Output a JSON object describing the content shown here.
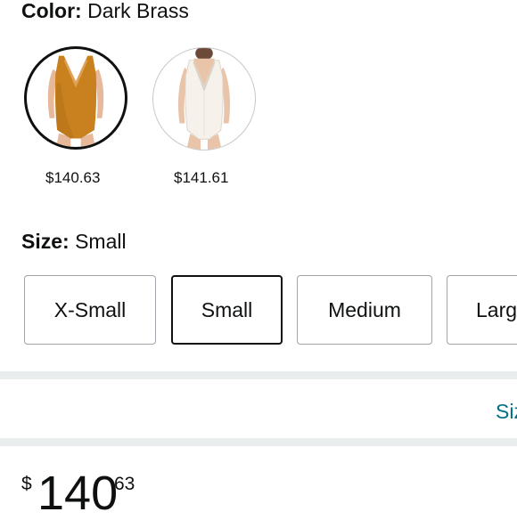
{
  "color": {
    "label": "Color:",
    "value": "Dark Brass",
    "options": [
      {
        "name": "Dark Brass",
        "price": "$140.63",
        "selected": true,
        "swatch_color": "#c8811e"
      },
      {
        "name": "Ivory",
        "price": "$141.61",
        "selected": false,
        "swatch_color": "#f3ede6"
      }
    ]
  },
  "size": {
    "label": "Size:",
    "value": "Small",
    "options": [
      {
        "label": "X-Small",
        "selected": false
      },
      {
        "label": "Small",
        "selected": true
      },
      {
        "label": "Medium",
        "selected": false
      },
      {
        "label": "Larg",
        "selected": false
      }
    ]
  },
  "size_chart": {
    "link_label": "Siz"
  },
  "price": {
    "symbol": "$",
    "whole": "140",
    "fraction": "63"
  },
  "colors": {
    "link": "#007185",
    "text": "#0f1111",
    "divider": "#eaeded"
  }
}
